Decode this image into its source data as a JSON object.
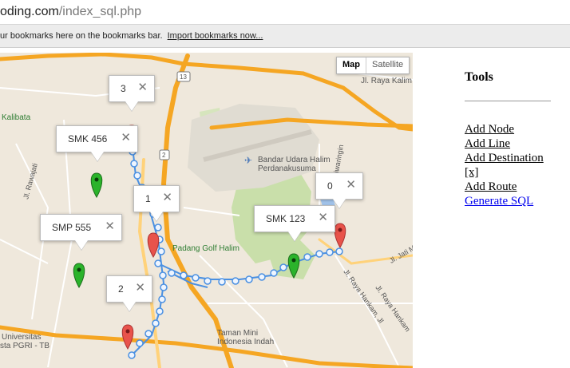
{
  "browser": {
    "url_host": "oding.com",
    "url_path": "/index_sql.php",
    "bookmark_message": "ur bookmarks here on the bookmarks bar.",
    "import_bookmarks": "Import bookmarks now..."
  },
  "map": {
    "map_button": "Map",
    "satellite_button": "Satellite",
    "labels": {
      "road_13": "13",
      "road_2": "2",
      "raya_kalim": "Jl. Raya Kalim",
      "kalibata": "Kalibata",
      "airport_1": "Bandar Udara Halim",
      "airport_2": "Perdanakusuma",
      "golf": "Padang Golf Halim",
      "taman_1": "Taman Mini",
      "taman_2": "Indonesia Indah",
      "universitas_1": "Universitas",
      "universitas_2": "sta PGRI - TB",
      "rawajati": "Jl. Rawajati",
      "jatiwaringin": "Jl. Jatiwaringin",
      "raya_hankam": "Jl. Raya Hankam, Jl",
      "raya_hankam2": "Jl. Raya Hankam",
      "jati_m": "Jl. Jati M"
    },
    "infowindows": [
      {
        "label": "3"
      },
      {
        "label": "SMK 456"
      },
      {
        "label": "1"
      },
      {
        "label": "0"
      },
      {
        "label": "SMK 123"
      },
      {
        "label": "SMP 555"
      },
      {
        "label": "2"
      }
    ],
    "close_glyph": "✕",
    "colors": {
      "red_marker": "#e8534b",
      "green_marker": "#2bb32b",
      "route": "#4a90e2",
      "highway": "#f5a623"
    }
  },
  "tools": {
    "title": "Tools",
    "links": [
      "Add Node",
      "Add Line",
      "Add Destination",
      "[x]",
      "Add Route",
      "Generate SQL"
    ]
  }
}
